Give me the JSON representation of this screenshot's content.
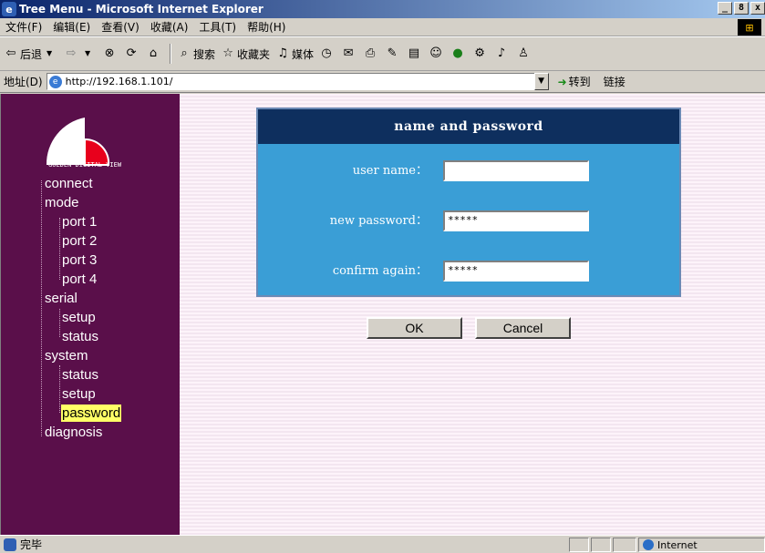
{
  "window": {
    "title": "Tree Menu - Microsoft Internet Explorer",
    "buttons": [
      "_",
      "8",
      "x"
    ]
  },
  "menubar": {
    "items": [
      "文件(F)",
      "编辑(E)",
      "查看(V)",
      "收藏(A)",
      "工具(T)",
      "帮助(H)"
    ]
  },
  "toolbar": {
    "back": "后退",
    "search": "搜索",
    "favorites": "收藏夹",
    "media": "媒体"
  },
  "address": {
    "label": "地址(D)",
    "url": "http://192.168.1.101/",
    "go": "转到",
    "links": "链接"
  },
  "sidebar": {
    "logo_text": "GOLDEN DIGITAL VIEW",
    "tree": [
      {
        "label": "connect",
        "level": 0
      },
      {
        "label": "mode",
        "level": 0
      },
      {
        "label": "port 1",
        "level": 1
      },
      {
        "label": "port 2",
        "level": 1
      },
      {
        "label": "port 3",
        "level": 1
      },
      {
        "label": "port 4",
        "level": 1
      },
      {
        "label": "serial",
        "level": 0
      },
      {
        "label": "setup",
        "level": 1
      },
      {
        "label": "status",
        "level": 1
      },
      {
        "label": "system",
        "level": 0
      },
      {
        "label": "status",
        "level": 1
      },
      {
        "label": "setup",
        "level": 1
      },
      {
        "label": "password",
        "level": 1,
        "selected": true
      },
      {
        "label": "diagnosis",
        "level": 0
      }
    ]
  },
  "form": {
    "title": "name and password",
    "user_name_label": "user name：",
    "user_name_value": "",
    "new_password_label": "new password：",
    "new_password_value": "*****",
    "confirm_label": "confirm again：",
    "confirm_value": "*****",
    "ok": "OK",
    "cancel": "Cancel"
  },
  "statusbar": {
    "status": "完毕",
    "zone": "Internet"
  },
  "colors": {
    "sidebar_bg": "#5a0f4a",
    "panel_head": "#0e2f5e",
    "panel_body": "#3a9ed6",
    "selected": "#ffff66"
  }
}
